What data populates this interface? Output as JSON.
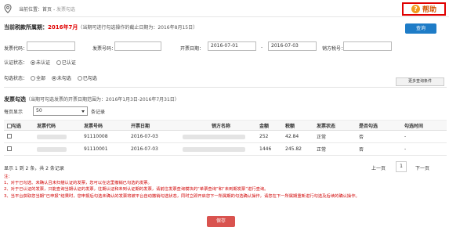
{
  "header": {
    "breadcrumb_prefix": "当前位置：",
    "breadcrumb_home": "首页",
    "breadcrumb_sep": " - ",
    "breadcrumb_current": "发票勾选",
    "help_label": "帮助"
  },
  "period": {
    "label": "当前税款所属期：",
    "month": "2016年7月",
    "note": "（当期可进行勾选操作的截止日期为：2016年8月15日）",
    "query_button": "查询"
  },
  "filters": {
    "invoice_code_label": "发票代码：",
    "invoice_number_label": "发票号码：",
    "date_label": "开票日期：",
    "date_from": "2016-07-01",
    "date_to": "2016-07-03",
    "date_sep": "-",
    "seller_taxid_label": "销方税号：",
    "auth_status_label": "认证状态：",
    "auth_options": [
      "未认证",
      "已认证"
    ],
    "select_status_label": "勾选状态：",
    "select_options": [
      "全部",
      "未勾选",
      "已勾选"
    ],
    "more_button": "更多查询条件"
  },
  "section": {
    "label": "发票勾选",
    "note": "（当期可勾选发票的开票日期范围为：2016年1月3日-2016年7月31日）"
  },
  "pagination": {
    "per_page_label": "每页显示",
    "per_page_value": "50",
    "records_label": "条记录",
    "summary": "显示 1 到 2 条，共 2 条记录",
    "prev": "上一页",
    "page": "1",
    "next": "下一页"
  },
  "table": {
    "columns": [
      "勾选",
      "发票代码",
      "发票号码",
      "开票日期",
      "销方名称",
      "金额",
      "税额",
      "发票状态",
      "是否勾选",
      "勾选时间"
    ],
    "rows": [
      {
        "code": "",
        "number": "91110008",
        "date": "2016-07-03",
        "seller": "",
        "amount": "252",
        "tax": "42.84",
        "status": "正常",
        "selected": "否",
        "time": "-"
      },
      {
        "code": "",
        "number": "91110001",
        "date": "2016-07-03",
        "seller": "",
        "amount": "1446",
        "tax": "245.82",
        "status": "正常",
        "selected": "否",
        "time": "-"
      }
    ]
  },
  "notes": {
    "title": "注：",
    "lines": [
      "1、对于已勾选、未确认且未扫描认证的发票，您可以在这里撤销已勾选的发票。",
      "2、对于已认证的发票，只能查询当期认证的发票，往期认证和未到认证期的发票，请前往发票查询模块的“单票查询”和“未到期发票”进行查询。",
      "3、当平台获取您当期“已申报”结果时，您申报后勾选未确认的发票将被平台自动撤销勾选状态，同时立即开启您下一所属期的勾选确认操作，请您在下一所属期重新进行勾选及后续的确认操作。"
    ]
  },
  "footer": {
    "save_button": "保存"
  }
}
